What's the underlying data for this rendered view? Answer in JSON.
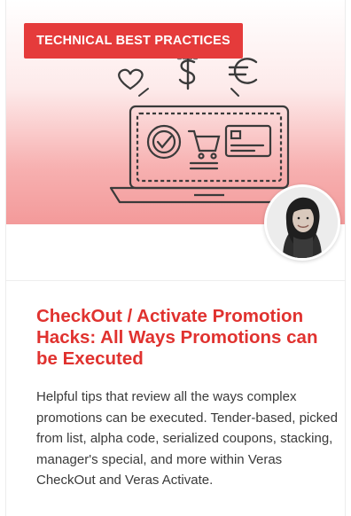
{
  "card": {
    "category_badge": "TECHNICAL BEST PRACTICES",
    "title": "CheckOut / Activate Promotion Hacks: All Ways Promotions can be Executed",
    "description": "Helpful tips that review all the ways complex promotions can be executed. Tender-based, picked from list, alpha code, serialized coupons, stacking, manager's special, and more within Veras CheckOut and Veras Activate.",
    "hero_icons": [
      "heart-icon",
      "dollar-icon",
      "euro-icon",
      "laptop-icon",
      "checkmark-badge-icon",
      "shopping-cart-icon",
      "credit-card-icon"
    ],
    "avatar": "author-avatar"
  },
  "colors": {
    "accent": "#e53b3b",
    "title": "#e0322f",
    "text": "#3a3a3a"
  }
}
